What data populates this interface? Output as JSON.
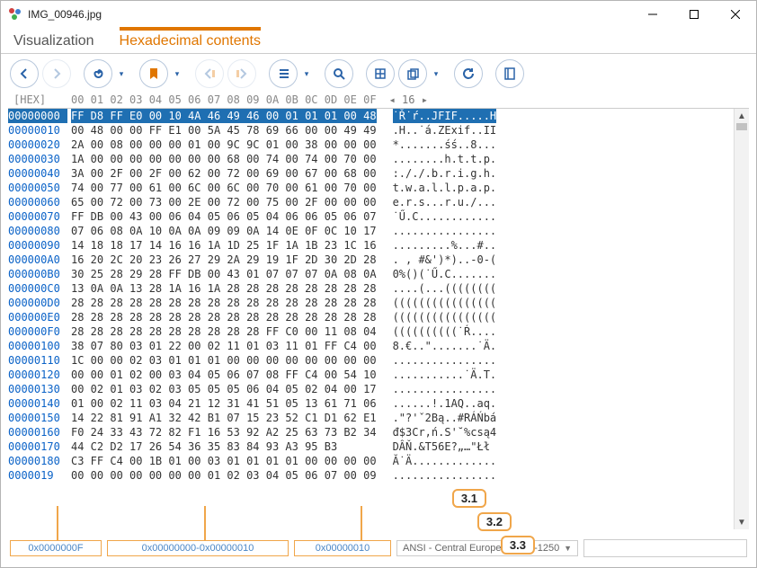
{
  "window": {
    "title": "IMG_00946.jpg"
  },
  "tabs": [
    {
      "label": "Visualization",
      "active": false
    },
    {
      "label": "Hexadecimal contents",
      "active": true
    }
  ],
  "hex": {
    "header_label": "[HEX]",
    "columns": "00 01 02 03 04 05 06 07 08 09 0A 0B 0C 0D 0E 0F",
    "visible_cols": "16",
    "rows": [
      {
        "addr": "00000000",
        "hex": "FF D8 FF E0 00 10 4A 46 49 46 00 01 01 01 00 48",
        "asc": "˙Ř˙ŕ..JFIF.....H",
        "sel": true
      },
      {
        "addr": "00000010",
        "hex": "00 48 00 00 FF E1 00 5A 45 78 69 66 00 00 49 49",
        "asc": ".H..˙á.ZExif..II"
      },
      {
        "addr": "00000020",
        "hex": "2A 00 08 00 00 00 01 00 9C 9C 01 00 38 00 00 00",
        "asc": "*.......śś..8..."
      },
      {
        "addr": "00000030",
        "hex": "1A 00 00 00 00 00 00 00 68 00 74 00 74 00 70 00",
        "asc": "........h.t.t.p."
      },
      {
        "addr": "00000040",
        "hex": "3A 00 2F 00 2F 00 62 00 72 00 69 00 67 00 68 00",
        "asc": ":././.b.r.i.g.h."
      },
      {
        "addr": "00000050",
        "hex": "74 00 77 00 61 00 6C 00 6C 00 70 00 61 00 70 00",
        "asc": "t.w.a.l.l.p.a.p."
      },
      {
        "addr": "00000060",
        "hex": "65 00 72 00 73 00 2E 00 72 00 75 00 2F 00 00 00",
        "asc": "e.r.s...r.u./..."
      },
      {
        "addr": "00000070",
        "hex": "FF DB 00 43 00 06 04 05 06 05 04 06 06 05 06 07",
        "asc": "˙Ű.C............"
      },
      {
        "addr": "00000080",
        "hex": "07 06 08 0A 10 0A 0A 09 09 0A 14 0E 0F 0C 10 17",
        "asc": "................"
      },
      {
        "addr": "00000090",
        "hex": "14 18 18 17 14 16 16 1A 1D 25 1F 1A 1B 23 1C 16",
        "asc": ".........%...#.."
      },
      {
        "addr": "000000A0",
        "hex": "16 20 2C 20 23 26 27 29 2A 29 19 1F 2D 30 2D 28",
        "asc": ". , #&')*)..-0-("
      },
      {
        "addr": "000000B0",
        "hex": "30 25 28 29 28 FF DB 00 43 01 07 07 07 0A 08 0A",
        "asc": "0%()(˙Ű.C......."
      },
      {
        "addr": "000000C0",
        "hex": "13 0A 0A 13 28 1A 16 1A 28 28 28 28 28 28 28 28",
        "asc": "....(...(((((((("
      },
      {
        "addr": "000000D0",
        "hex": "28 28 28 28 28 28 28 28 28 28 28 28 28 28 28 28",
        "asc": "(((((((((((((((("
      },
      {
        "addr": "000000E0",
        "hex": "28 28 28 28 28 28 28 28 28 28 28 28 28 28 28 28",
        "asc": "(((((((((((((((("
      },
      {
        "addr": "000000F0",
        "hex": "28 28 28 28 28 28 28 28 28 28 FF C0 00 11 08 04",
        "asc": "((((((((((˙Ŕ...."
      },
      {
        "addr": "00000100",
        "hex": "38 07 80 03 01 22 00 02 11 01 03 11 01 FF C4 00",
        "asc": "8.€..\".......˙Ä."
      },
      {
        "addr": "00000110",
        "hex": "1C 00 00 02 03 01 01 01 00 00 00 00 00 00 00 00",
        "asc": "................"
      },
      {
        "addr": "00000120",
        "hex": "00 00 01 02 00 03 04 05 06 07 08 FF C4 00 54 10",
        "asc": "...........˙Ä.T."
      },
      {
        "addr": "00000130",
        "hex": "00 02 01 03 02 03 05 05 05 06 04 05 02 04 00 17",
        "asc": "................"
      },
      {
        "addr": "00000140",
        "hex": "01 00 02 11 03 04 21 12 31 41 51 05 13 61 71 06",
        "asc": "......!.1AQ..aq."
      },
      {
        "addr": "00000150",
        "hex": "14 22 81 91 A1 32 42 B1 07 15 23 52 C1 D1 62 E1",
        "asc": ".\"?'ˇ2Bą..#RÁŃbá"
      },
      {
        "addr": "00000160",
        "hex": "F0 24 33 43 72 82 F1 16 53 92 A2 25 63 73 B2 34",
        "asc": "đ$3Cr‚ń.S'˘%csą4"
      },
      {
        "addr": "00000170",
        "hex": "44 C2 D2 17 26 54 36 35 83 84 93 A3 95 B3",
        "asc": "DÂŇ.&T56E?„…\"Łł"
      },
      {
        "addr": "00000180",
        "hex": "C3 FF C4 00 1B 01 00 03 01 01 01 01 00 00 00 00",
        "asc": "Ă˙Ä............."
      },
      {
        "addr": "0000019",
        "hex": "00 00 00 00 00 00 00 01 02 03 04 05 06 07 00 09",
        "asc": "................"
      }
    ]
  },
  "status": {
    "offset": "0x0000000F",
    "range": "0x00000000-0x00000010",
    "length": "0x00000010",
    "encoding": "ANSI - Central European / CP-1250"
  },
  "callouts": [
    "3.1",
    "3.2",
    "3.3"
  ]
}
